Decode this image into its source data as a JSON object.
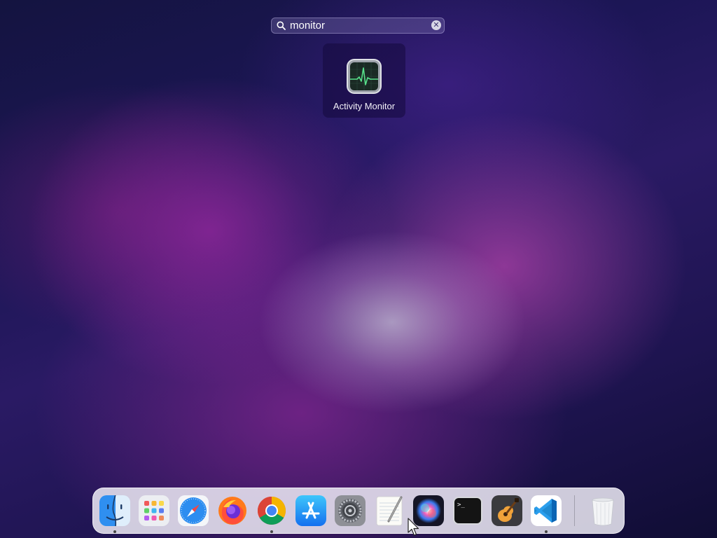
{
  "search": {
    "value": "monitor",
    "placeholder": "Search"
  },
  "results": [
    {
      "label": "Activity Monitor",
      "icon": "activity-monitor-icon"
    }
  ],
  "dock": {
    "items": [
      {
        "name": "Finder",
        "icon": "finder-icon",
        "running": true
      },
      {
        "name": "Launchpad",
        "icon": "launchpad-icon",
        "running": false
      },
      {
        "name": "Safari",
        "icon": "safari-icon",
        "running": false
      },
      {
        "name": "Firefox",
        "icon": "firefox-icon",
        "running": false
      },
      {
        "name": "Google Chrome",
        "icon": "chrome-icon",
        "running": true
      },
      {
        "name": "App Store",
        "icon": "app-store-icon",
        "running": false
      },
      {
        "name": "System Preferences",
        "icon": "system-preferences-icon",
        "running": false
      },
      {
        "name": "TextEdit",
        "icon": "textedit-icon",
        "running": false
      },
      {
        "name": "Siri",
        "icon": "siri-icon",
        "running": false
      },
      {
        "name": "Terminal",
        "icon": "terminal-icon",
        "running": false
      },
      {
        "name": "GarageBand",
        "icon": "garageband-icon",
        "running": false
      },
      {
        "name": "Visual Studio Code",
        "icon": "vscode-icon",
        "running": true
      },
      {
        "name": "Trash",
        "icon": "trash-icon",
        "running": false
      }
    ]
  },
  "colors": {
    "accent": "#3b82f6",
    "wallpaper_dark": "#141440",
    "wallpaper_magenta": "#b440b4"
  }
}
